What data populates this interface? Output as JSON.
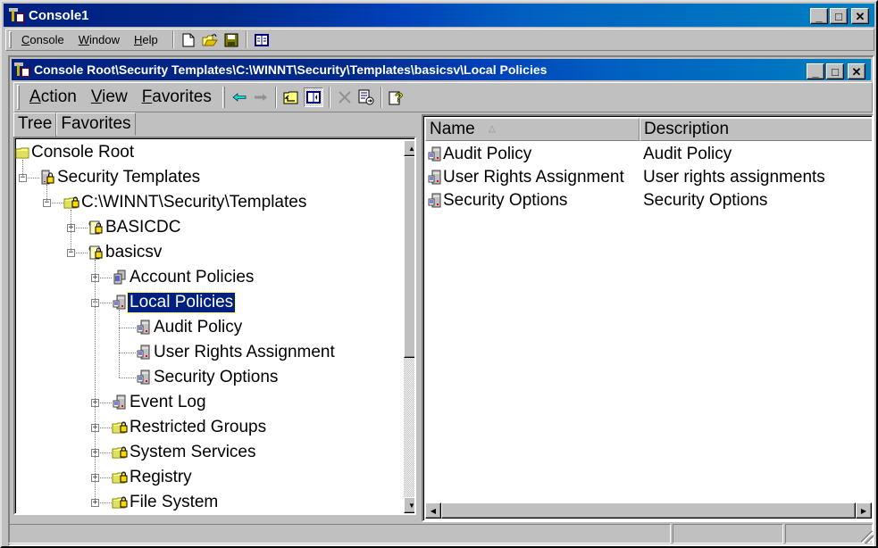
{
  "app": {
    "title": "Console1",
    "menu": [
      {
        "label": "Console",
        "accel": "C",
        "rest": "onsole"
      },
      {
        "label": "Window",
        "accel": "W",
        "rest": "indow"
      },
      {
        "label": "Help",
        "accel": "H",
        "rest": "elp"
      }
    ],
    "toolbar_icons": [
      "new-document-icon",
      "open-folder-icon",
      "save-icon",
      "show-hide-console-tree-icon"
    ],
    "window_buttons": {
      "minimize": "_",
      "maximize": "□",
      "close": "✕"
    }
  },
  "child_window": {
    "title": "Console Root\\Security Templates\\C:\\WINNT\\Security\\Templates\\basicsv\\Local Policies",
    "action_menu": [
      {
        "label": "Action",
        "accel": "A",
        "rest": "ction"
      },
      {
        "label": "View",
        "accel": "V",
        "rest": "iew"
      },
      {
        "label": "Favorites",
        "accel": "F",
        "rest": "avorites"
      }
    ],
    "toolbar_icons": [
      "back-arrow-icon",
      "forward-arrow-icon",
      "up-one-level-icon",
      "show-hide-tree-icon",
      "delete-icon",
      "export-list-icon",
      "help-icon"
    ]
  },
  "tabs": [
    {
      "label": "Tree",
      "active": true
    },
    {
      "label": "Favorites",
      "active": false
    }
  ],
  "tree": [
    {
      "label": "Console Root",
      "level": 0,
      "expander": "none",
      "icon": "folder"
    },
    {
      "label": "Security Templates",
      "level": 1,
      "expander": "minus",
      "icon": "server-lock"
    },
    {
      "label": "C:\\WINNT\\Security\\Templates",
      "level": 2,
      "expander": "minus",
      "icon": "folder-lock"
    },
    {
      "label": "BASICDC",
      "level": 3,
      "expander": "plus",
      "icon": "template-lock"
    },
    {
      "label": "basicsv",
      "level": 3,
      "expander": "minus",
      "icon": "template-lock"
    },
    {
      "label": "Account Policies",
      "level": 4,
      "expander": "plus",
      "icon": "policy-servers"
    },
    {
      "label": "Local Policies",
      "level": 4,
      "expander": "minus",
      "icon": "policy-server",
      "selected": true
    },
    {
      "label": "Audit Policy",
      "level": 5,
      "expander": "none",
      "icon": "policy-server"
    },
    {
      "label": "User Rights Assignment",
      "level": 5,
      "expander": "none",
      "icon": "policy-server"
    },
    {
      "label": "Security Options",
      "level": 5,
      "expander": "none",
      "icon": "policy-server"
    },
    {
      "label": "Event Log",
      "level": 4,
      "expander": "plus",
      "icon": "policy-server"
    },
    {
      "label": "Restricted Groups",
      "level": 4,
      "expander": "plus",
      "icon": "folder-lock"
    },
    {
      "label": "System Services",
      "level": 4,
      "expander": "plus",
      "icon": "folder-lock"
    },
    {
      "label": "Registry",
      "level": 4,
      "expander": "plus",
      "icon": "folder-lock"
    },
    {
      "label": "File System",
      "level": 4,
      "expander": "plus",
      "icon": "folder-lock"
    }
  ],
  "list": {
    "columns": [
      {
        "label": "Name",
        "sort": "ascending"
      },
      {
        "label": "Description"
      }
    ],
    "rows": [
      {
        "name": "Audit Policy",
        "description": "Audit Policy"
      },
      {
        "name": "User Rights Assignment",
        "description": "User rights assignments"
      },
      {
        "name": "Security Options",
        "description": "Security Options"
      }
    ]
  },
  "statusbar": {
    "panels": [
      "",
      "",
      ""
    ]
  }
}
